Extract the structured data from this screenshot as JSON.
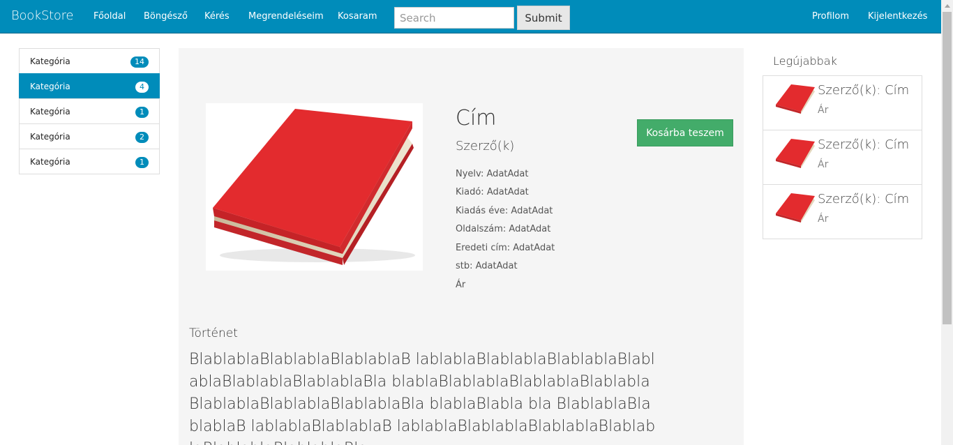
{
  "navbar": {
    "brand": "BookStore",
    "links": [
      "Főoldal",
      "Böngésző",
      "Kérés",
      "Megrendeléseim",
      "Kosaram"
    ],
    "search_placeholder": "Search",
    "submit_label": "Submit",
    "right_links": [
      "Profilom",
      "Kijelentkezés"
    ]
  },
  "categories": [
    {
      "label": "Kategória",
      "count": "14"
    },
    {
      "label": "Kategória",
      "count": "4"
    },
    {
      "label": "Kategória",
      "count": "1"
    },
    {
      "label": "Kategória",
      "count": "2"
    },
    {
      "label": "Kategória",
      "count": "1"
    }
  ],
  "book": {
    "title": "Cím",
    "author": "Szerző(k)",
    "attributes": [
      "Nyelv: AdatAdat",
      "Kiadó: AdatAdat",
      "Kiadás éve: AdatAdat",
      "Oldalszám: AdatAdat",
      "Eredeti cím: AdatAdat",
      "stb: AdatAdat",
      "Ár"
    ],
    "cart_button": "Kosárba teszem",
    "story_heading": "Történet",
    "story_text": "BlablablaBlablablaBlablablaB lablablaBlablablaBlablablaBlablablaBlablablaBlablablaBla blablaBlablablaBlablablaBlablablaBlablablaBlablablaBlablablaBla blablaBlabla bla BlablablaBlablablaB lablablaBlablablaB lablablaBlablablaBlablablaBlablablaBlablablaBlablablaBla"
  },
  "newest": {
    "heading": "Legújabbak",
    "items": [
      {
        "title": "Szerző(k): Cím",
        "price": "Ár"
      },
      {
        "title": "Szerző(k): Cím",
        "price": "Ár"
      },
      {
        "title": "Szerző(k): Cím",
        "price": "Ár"
      }
    ]
  },
  "colors": {
    "primary": "#008cba",
    "success": "#43ac6a",
    "book_red": "#e23636"
  }
}
